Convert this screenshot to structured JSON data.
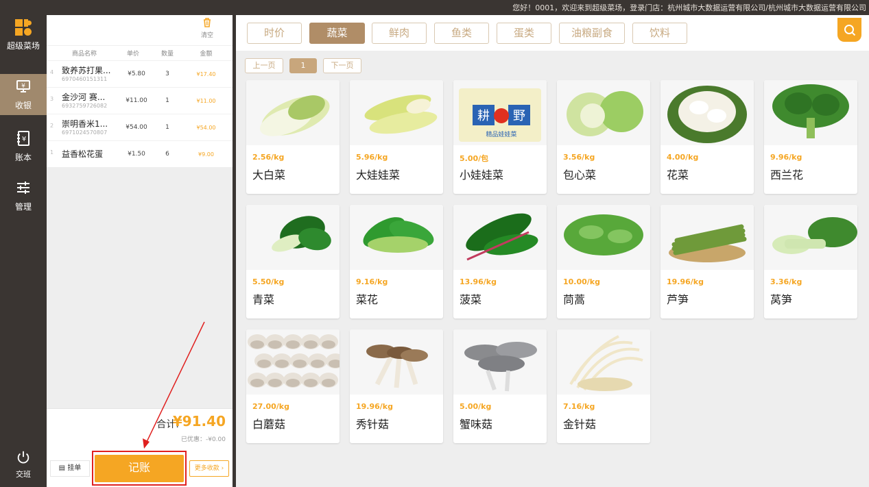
{
  "topbar": {
    "welcome": "您好！0001，欢迎来到超级菜场，登录门店：杭州城市大数据运营有限公司/杭州城市大数据运营有限公司"
  },
  "sidebar": {
    "brand": "超级菜场",
    "items": [
      {
        "label": "收银",
        "icon": "cashier-icon"
      },
      {
        "label": "账本",
        "icon": "ledger-icon"
      },
      {
        "label": "管理",
        "icon": "settings-sliders-icon"
      }
    ],
    "bottom": {
      "label": "交班",
      "icon": "power-icon"
    }
  },
  "cart": {
    "clear_label": "清空",
    "headers": {
      "name": "商品名称",
      "price": "单价",
      "qty": "数量",
      "amount": "金额"
    },
    "rows": [
      {
        "idx": "4",
        "name": "致养苏打果...",
        "code": "6970460151311",
        "price": "¥5.80",
        "qty": "3",
        "amount": "¥17.40"
      },
      {
        "idx": "3",
        "name": "金沙河 赛...",
        "code": "6932759726082",
        "price": "¥11.00",
        "qty": "1",
        "amount": "¥11.00"
      },
      {
        "idx": "2",
        "name": "崇明香米1...",
        "code": "6971024570807",
        "price": "¥54.00",
        "qty": "1",
        "amount": "¥54.00"
      },
      {
        "idx": "1",
        "name": "益香松花蛋",
        "code": "",
        "price": "¥1.50",
        "qty": "6",
        "amount": "¥9.00"
      }
    ],
    "total_label": "合计:",
    "total_value": "¥91.40",
    "discount": "已优惠：-¥0.00",
    "hold_label": "挂单",
    "pay_label": "记账",
    "more_label": "更多收款"
  },
  "categories": [
    {
      "label": "时价",
      "active": false
    },
    {
      "label": "蔬菜",
      "active": true
    },
    {
      "label": "鲜肉",
      "active": false
    },
    {
      "label": "鱼类",
      "active": false
    },
    {
      "label": "蛋类",
      "active": false
    },
    {
      "label": "油粮副食",
      "active": false
    },
    {
      "label": "饮料",
      "active": false
    }
  ],
  "pager": {
    "prev": "上一页",
    "current": "1",
    "next": "下一页"
  },
  "products": [
    {
      "name": "大白菜",
      "price": "2.56/kg"
    },
    {
      "name": "大娃娃菜",
      "price": "5.96/kg"
    },
    {
      "name": "小娃娃菜",
      "price": "5.00/包"
    },
    {
      "name": "包心菜",
      "price": "3.56/kg"
    },
    {
      "name": "花菜",
      "price": "4.00/kg"
    },
    {
      "name": "西兰花",
      "price": "9.96/kg"
    },
    {
      "name": "青菜",
      "price": "5.50/kg"
    },
    {
      "name": "菜花",
      "price": "9.16/kg"
    },
    {
      "name": "菠菜",
      "price": "13.96/kg"
    },
    {
      "name": "茼蒿",
      "price": "10.00/kg"
    },
    {
      "name": "芦笋",
      "price": "19.96/kg"
    },
    {
      "name": "莴笋",
      "price": "3.36/kg"
    },
    {
      "name": "白蘑菇",
      "price": "27.00/kg"
    },
    {
      "name": "秀针菇",
      "price": "19.96/kg"
    },
    {
      "name": "蟹味菇",
      "price": "5.00/kg"
    },
    {
      "name": "金针菇",
      "price": "7.16/kg"
    }
  ],
  "package_text": {
    "brand_left": "耕",
    "brand_right": "野",
    "subtitle": "精品娃娃菜"
  },
  "colors": {
    "accent": "#f5a623",
    "brand_tan": "#b08d67",
    "sidebar_bg": "#3a3532",
    "highlight_red": "#e0201f"
  }
}
